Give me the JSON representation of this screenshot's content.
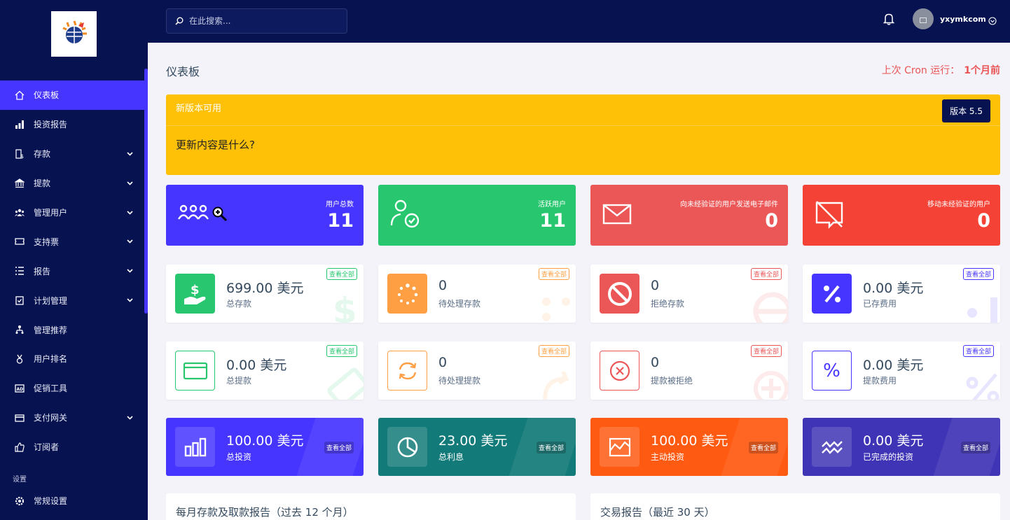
{
  "sidebar": {
    "items": [
      {
        "label": "仪表板",
        "icon": "home-icon",
        "active": true
      },
      {
        "label": "投资报告",
        "icon": "bar-chart-icon"
      },
      {
        "label": "存款",
        "icon": "deposit-icon",
        "has_submenu": true
      },
      {
        "label": "提款",
        "icon": "bank-icon",
        "has_submenu": true
      },
      {
        "label": "管理用户",
        "icon": "users-icon",
        "has_submenu": true
      },
      {
        "label": "支持票",
        "icon": "ticket-icon",
        "has_submenu": true
      },
      {
        "label": "报告",
        "icon": "list-icon",
        "has_submenu": true
      },
      {
        "label": "计划管理",
        "icon": "clipboard-icon",
        "has_submenu": true
      },
      {
        "label": "管理推荐",
        "icon": "tree-icon"
      },
      {
        "label": "用户排名",
        "icon": "medal-icon"
      },
      {
        "label": "促销工具",
        "icon": "ad-icon"
      },
      {
        "label": "支付网关",
        "icon": "credit-card-icon",
        "has_submenu": true
      },
      {
        "label": "订阅者",
        "icon": "thumbs-up-icon"
      }
    ],
    "section_label": "设置",
    "bottom_items": [
      {
        "label": "常规设置",
        "icon": "gear-icon"
      }
    ]
  },
  "topbar": {
    "search_placeholder": "在此搜索...",
    "username": "yxymkcom"
  },
  "header": {
    "title": "仪表板",
    "cron_label": "上次 Cron 运行：",
    "cron_value": "1个月前"
  },
  "banner": {
    "title": "新版本可用",
    "body": "更新内容是什么?",
    "version": "版本 5.5"
  },
  "stats_top": [
    {
      "label": "用户总数",
      "value": "11",
      "color": "#4634ff"
    },
    {
      "label": "活跃用户",
      "value": "11",
      "color": "#28c76f"
    },
    {
      "label": "向未经验证的用户发送电子邮件",
      "value": "0",
      "color": "#eb5757"
    },
    {
      "label": "移动未经验证的用户",
      "value": "0",
      "color": "#f44336"
    }
  ],
  "view_all": "查看全部",
  "stats_deposit": [
    {
      "value": "699.00 美元",
      "caption": "总存款",
      "color": "#28c76f"
    },
    {
      "value": "0",
      "caption": "待处理存款",
      "color": "#ff9f43"
    },
    {
      "value": "0",
      "caption": "拒绝存款",
      "color": "#eb5757"
    },
    {
      "value": "0.00 美元",
      "caption": "已存费用",
      "color": "#4634ff"
    }
  ],
  "stats_withdraw": [
    {
      "value": "0.00 美元",
      "caption": "总提款",
      "color": "#28c76f"
    },
    {
      "value": "0",
      "caption": "待处理提款",
      "color": "#ff9f43"
    },
    {
      "value": "0",
      "caption": "提款被拒绝",
      "color": "#eb5757"
    },
    {
      "value": "0.00 美元",
      "caption": "提款费用",
      "color": "#4634ff"
    }
  ],
  "stats_invest": [
    {
      "value": "100.00 美元",
      "caption": "总投资",
      "color": "#4634ff"
    },
    {
      "value": "23.00 美元",
      "caption": "总利息",
      "color": "#127a78"
    },
    {
      "value": "100.00 美元",
      "caption": "主动投资",
      "color": "#ff5a12"
    },
    {
      "value": "0.00 美元",
      "caption": "已完成的投资",
      "color": "#3f34b6"
    }
  ],
  "reports": {
    "monthly": "每月存款及取款报告（过去 12 个月）",
    "transactions": "交易报告（最近 30 天）"
  }
}
